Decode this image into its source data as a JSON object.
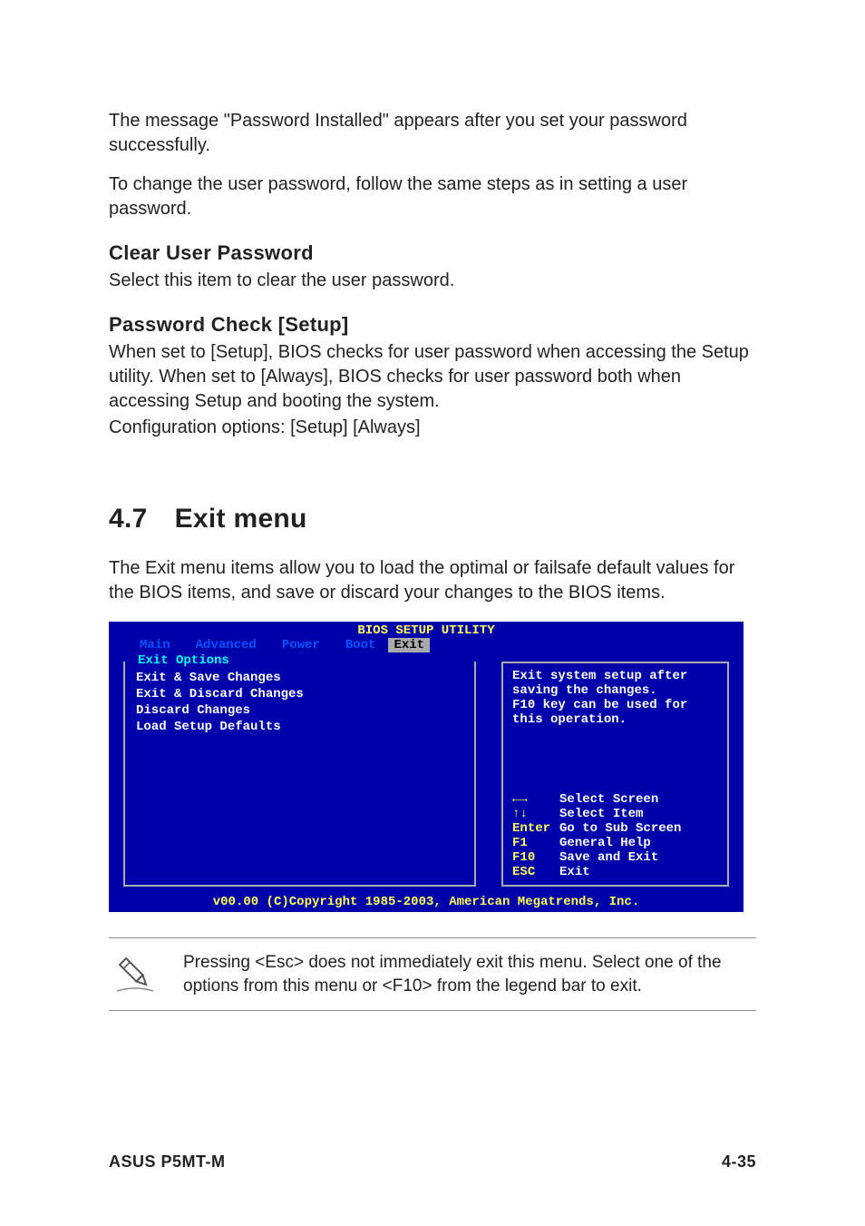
{
  "intro": {
    "p1": "The message \"Password Installed\" appears after you set your password successfully.",
    "p2": "To change the user password, follow the same steps as in setting a user password."
  },
  "clear_pw": {
    "heading": "Clear User Password",
    "body": "Select this item to clear the user password."
  },
  "pw_check": {
    "heading": "Password Check [Setup]",
    "body1": "When set to [Setup], BIOS checks for user password when accessing the Setup utility. When set to [Always], BIOS checks for user password both when accessing Setup and booting the system.",
    "body2": "Configuration options: [Setup] [Always]"
  },
  "section": {
    "number": "4.7",
    "title": "Exit menu",
    "intro": "The Exit menu items allow you to load the optimal or failsafe default values for the BIOS items, and save or discard your changes to the BIOS items."
  },
  "bios": {
    "title": "BIOS SETUP UTILITY",
    "tabs": [
      "Main",
      "Advanced",
      "Power",
      "Boot",
      "Exit"
    ],
    "active_tab_index": 4,
    "left_legend": "Exit Options",
    "items": [
      "Exit & Save Changes",
      "Exit & Discard Changes",
      "Discard Changes",
      "",
      "Load Setup Defaults"
    ],
    "help_text": "Exit system setup after saving the changes.\nF10 key can be used for this operation.",
    "keys": [
      {
        "key": "←→",
        "action": "Select Screen"
      },
      {
        "key": "↑↓",
        "action": "Select Item"
      },
      {
        "key": "Enter",
        "action": "Go to Sub Screen"
      },
      {
        "key": "F1",
        "action": "General Help"
      },
      {
        "key": "F10",
        "action": "Save and Exit"
      },
      {
        "key": "ESC",
        "action": "Exit"
      }
    ],
    "footer": "v00.00 (C)Copyright 1985-2003, American Megatrends, Inc."
  },
  "note": {
    "text": "Pressing <Esc> does not immediately exit this menu. Select one of the options from this menu or <F10> from the legend bar to exit."
  },
  "footer": {
    "left": "ASUS P5MT-M",
    "right": "4-35"
  }
}
